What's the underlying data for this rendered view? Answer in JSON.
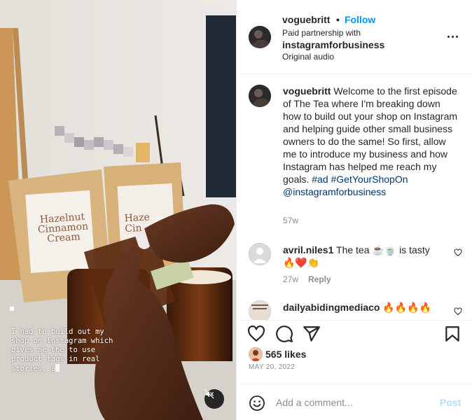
{
  "media": {
    "overlay_text": "I had to build out my shop on Instagram which gives me the to use product tags in real stories, a",
    "product_labels": {
      "left_line1": "Hazelnut",
      "left_line2": "Cinnamon",
      "left_line3": "Cream",
      "right_line1": "Haze",
      "right_line2": "Cin"
    },
    "mute_icon": "speaker-muted-icon"
  },
  "header": {
    "username": "voguebritt",
    "separator": "•",
    "follow_label": "Follow",
    "paid_label": "Paid partnership with",
    "partner": "instagramforbusiness",
    "audio": "Original audio",
    "more_icon": "more-horizontal-icon"
  },
  "caption": {
    "username": "voguebritt",
    "text": "Welcome to the first episode of The Tea where I'm breaking down how to build out your shop on Instagram and helping guide other small business owners to do the same! So first, allow me to introduce my business and how Instagram has helped me reach my goals.",
    "tag1": "#ad",
    "tag2": "#GetYourShopOn",
    "mention": "@instagramforbusiness",
    "time": "57w"
  },
  "comments": [
    {
      "username": "avril.niles1",
      "text": "The tea ☕🍵 is tasty 🔥❤️👏",
      "time": "27w",
      "reply_label": "Reply"
    },
    {
      "username": "dailyabidingmediaco",
      "text": "🔥🔥🔥🔥"
    }
  ],
  "actions": {
    "likes": "565 likes",
    "date": "MAY 20, 2022",
    "icons": [
      "heart-icon",
      "comment-icon",
      "share-icon",
      "bookmark-icon"
    ]
  },
  "add_comment": {
    "placeholder": "Add a comment...",
    "post_label": "Post",
    "emoji_icon": "emoji-icon"
  },
  "colors": {
    "link_blue": "#0095f6",
    "tag_blue": "#00376b",
    "muted": "#8e8e8e",
    "post_disabled": "#b2dffc"
  }
}
